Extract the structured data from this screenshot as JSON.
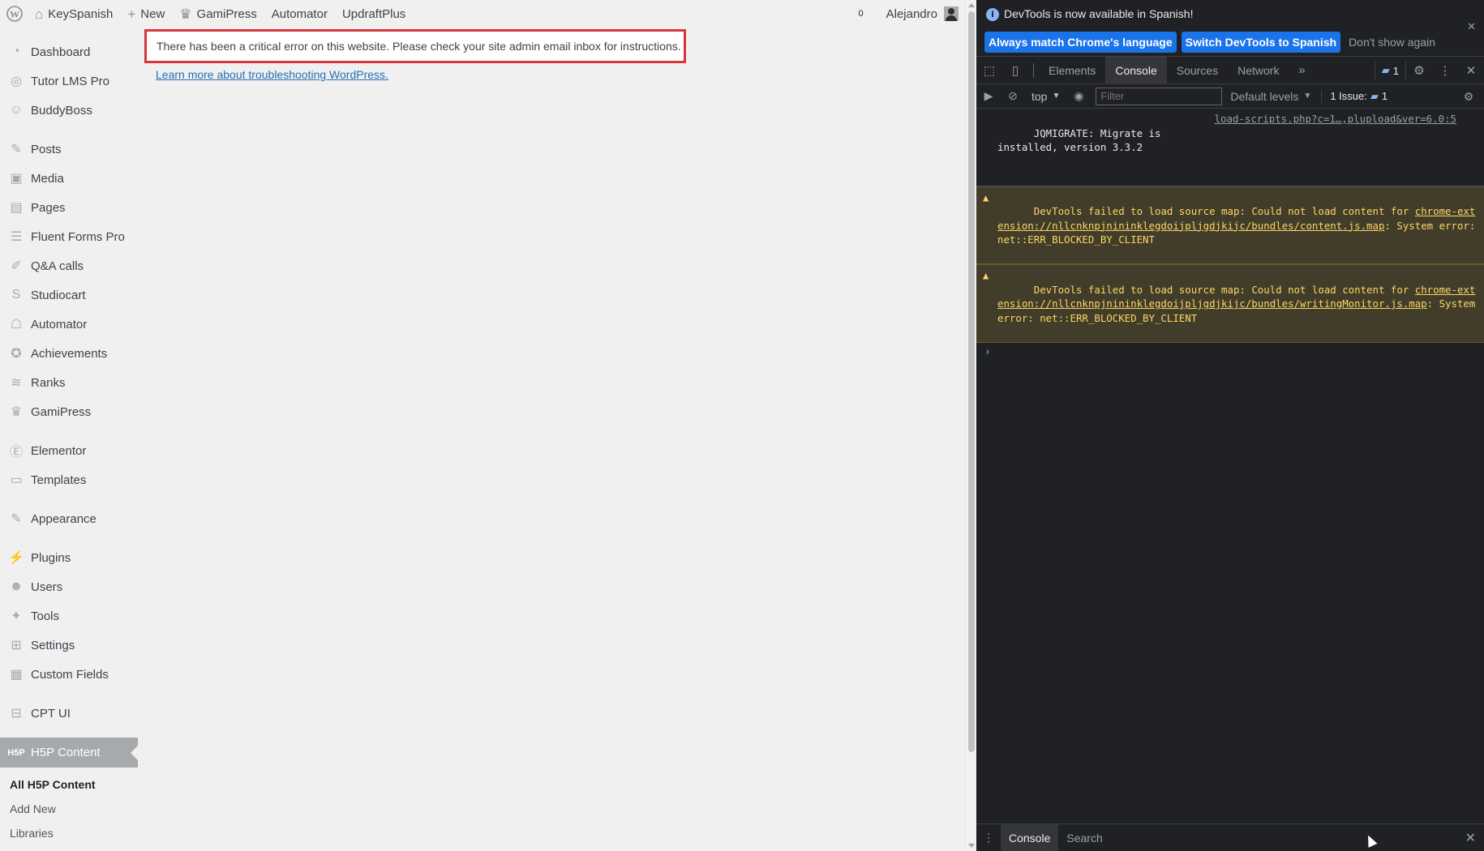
{
  "admin_bar": {
    "site_name": "KeySpanish",
    "new_label": "New",
    "gamipress_label": "GamiPress",
    "automator_label": "Automator",
    "updraft_label": "UpdraftPlus",
    "comment_count": "0",
    "user_name": "Alejandro"
  },
  "sidebar": {
    "items": [
      {
        "label": "Dashboard",
        "icon": "dashboard-icon",
        "glyph": "◔"
      },
      {
        "label": "Tutor LMS Pro",
        "icon": "tutor-icon",
        "glyph": "◎"
      },
      {
        "label": "BuddyBoss",
        "icon": "buddyboss-icon",
        "glyph": "☺"
      },
      {
        "label": "Posts",
        "icon": "pin-icon",
        "glyph": "✎"
      },
      {
        "label": "Media",
        "icon": "media-icon",
        "glyph": "▣"
      },
      {
        "label": "Pages",
        "icon": "pages-icon",
        "glyph": "▤"
      },
      {
        "label": "Fluent Forms Pro",
        "icon": "forms-icon",
        "glyph": "☰"
      },
      {
        "label": "Q&A calls",
        "icon": "pencil-icon",
        "glyph": "✐"
      },
      {
        "label": "Studiocart",
        "icon": "studiocart-icon",
        "glyph": "S"
      },
      {
        "label": "Automator",
        "icon": "robot-icon",
        "glyph": "☖"
      },
      {
        "label": "Achievements",
        "icon": "award-icon",
        "glyph": "✪"
      },
      {
        "label": "Ranks",
        "icon": "ranks-icon",
        "glyph": "≋"
      },
      {
        "label": "GamiPress",
        "icon": "crown-icon",
        "glyph": "♛"
      },
      {
        "label": "Elementor",
        "icon": "elementor-icon",
        "glyph": "Ⓔ"
      },
      {
        "label": "Templates",
        "icon": "folder-icon",
        "glyph": "▭"
      },
      {
        "label": "Appearance",
        "icon": "brush-icon",
        "glyph": "✎"
      },
      {
        "label": "Plugins",
        "icon": "plug-icon",
        "glyph": "⚡"
      },
      {
        "label": "Users",
        "icon": "user-icon",
        "glyph": "☻"
      },
      {
        "label": "Tools",
        "icon": "wrench-icon",
        "glyph": "✦"
      },
      {
        "label": "Settings",
        "icon": "settings-icon",
        "glyph": "⊞"
      },
      {
        "label": "Custom Fields",
        "icon": "table-icon",
        "glyph": "▦"
      },
      {
        "label": "CPT UI",
        "icon": "grid-icon",
        "glyph": "⊟"
      },
      {
        "label": "H5P Content",
        "icon": "h5p-icon",
        "glyph": "H5P"
      }
    ],
    "submenu": [
      "All H5P Content",
      "Add New",
      "Libraries"
    ]
  },
  "main": {
    "error_message": "There has been a critical error on this website. Please check your site admin email inbox for instructions.",
    "learn_link": "Learn more about troubleshooting WordPress."
  },
  "devtools": {
    "banner_text": "DevTools is now available in Spanish!",
    "btn_match": "Always match Chrome's language",
    "btn_switch": "Switch DevTools to Spanish",
    "btn_dismiss": "Don't show again",
    "tabs": [
      "Elements",
      "Console",
      "Sources",
      "Network"
    ],
    "messages_count": "1",
    "context": "top",
    "filter_placeholder": "Filter",
    "levels": "Default levels",
    "issues_label": "1 Issue:",
    "issues_count": "1",
    "logs": {
      "jqmigrate_text": "JQMIGRATE: Migrate is\ninstalled, version 3.3.2",
      "jqmigrate_src": "load-scripts.php?c=1…,plupload&ver=6.0:5",
      "warn1_prefix": "DevTools failed to load source map: Could not load content for ",
      "warn1_link": "chrome-extension://nllcnknpjnininklegdoijpljgdjkijc/bundles/content.js.map",
      "warn1_suffix": ": System error: net::ERR_BLOCKED_BY_CLIENT",
      "warn2_prefix": "DevTools failed to load source map: Could not load content for ",
      "warn2_link": "chrome-extension://nllcnknpjnininklegdoijpljgdjkijc/bundles/writingMonitor.js.map",
      "warn2_suffix": ": System error: net::ERR_BLOCKED_BY_CLIENT"
    },
    "drawer_tabs": [
      "Console",
      "Search"
    ]
  }
}
